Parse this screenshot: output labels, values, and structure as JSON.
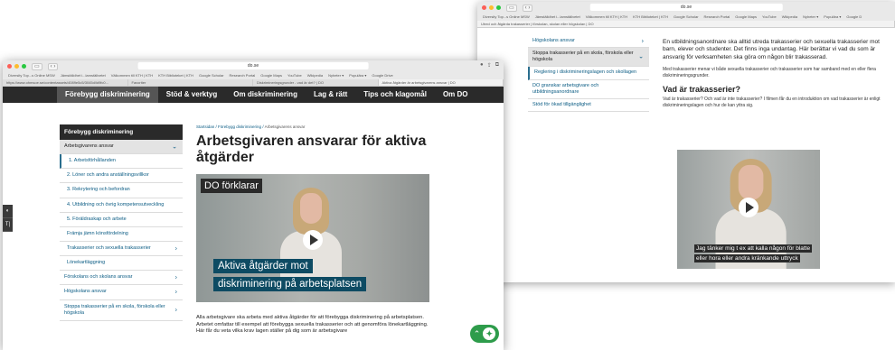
{
  "back_window": {
    "url": "do.se",
    "bookmarks": [
      "Diversity Top...s Online MSW",
      "Jämställdhet i...lamställvetet",
      "Välkommen till KTH | KTH",
      "KTH Biblioteket | KTH",
      "Google Scholar",
      "Research Portal",
      "Google Maps",
      "YouTube",
      "Wikipedia",
      "Nyheter ▾",
      "Populära ▾",
      "Google D"
    ],
    "tab": "Utred och åtgärda trakasserier | förskolan, skolan eller högskolan | DO",
    "sidebar": [
      {
        "label": "Högskolans ansvar",
        "arrow": "›"
      },
      {
        "label": "Stoppa trakasserier på en skola, förskola eller högskola",
        "arrow": "⌄",
        "state": "selected"
      },
      {
        "label": "Reglering i diskrimineringslagen och skollagen",
        "state": "sub-selected"
      },
      {
        "label": "DO granskar arbetsgivare och utbildningsanordnare"
      },
      {
        "label": "Stöd för ökad tillgänglighet"
      }
    ],
    "intro": "En utbildningsanordnare ska alltid utreda trakasserier och sexuella trakasserier mot barn, elever och studenter. Det finns inga undantag. Här berättar vi vad du som är ansvarig för verksamheten ska göra om någon blir trakasserad.",
    "para2": "Med trakasserier menar vi både sexuella trakasserier och trakasserier som har samband med en eller flera diskrimineringsgrunder.",
    "heading": "Vad är trakasserier?",
    "para3": "Vad är trakasserier? Och vad är inte trakasserier? I filmen får du en introduktion om vad trakasserier är enligt diskrimineringslagen och hur de kan yttra sig.",
    "video_subtitles": [
      "Jag tänker mig t ex att kalla någon för blatte",
      "eller hora eller andra kränkande uttryck"
    ]
  },
  "front_window": {
    "url": "do.se",
    "bookmarks": [
      "Diversity Top...s Online MSW",
      "Jämställdhet i...lamställvetet",
      "Välkommen till KTH | KTH",
      "KTH Biblioteket | KTH",
      "Google Scholar",
      "Research Portal",
      "Google Maps",
      "YouTube",
      "Wikipedia",
      "Nyheter ▾",
      "Populära ▾",
      "Google Drive"
    ],
    "tabs": [
      "https://www.ohmsoe.se/contentassets/4089e5c5/3045d/ld9fc0...",
      "Favoriter",
      "Diskrimineringsgrunder - vad är det? | DO",
      "Aktiva åtgärder är arbetsgivarens ansvar | DO"
    ],
    "nav": [
      "Förebygg diskriminering",
      "Stöd & verktyg",
      "Om diskriminering",
      "Lag & rätt",
      "Tips och klagomål",
      "Om DO"
    ],
    "side_tools": [
      "◐",
      "T|"
    ],
    "sidebar_title": "Förebygg diskriminering",
    "sidebar": [
      {
        "label": "Arbetsgivarens ansvar",
        "arrow": "⌄",
        "state": "selected"
      },
      {
        "label": "1. Arbetsförhållanden",
        "state": "sub-selected"
      },
      {
        "label": "2. Löner och andra anställningsvillkor",
        "state": "sub"
      },
      {
        "label": "3. Rekrytering och befordran",
        "state": "sub"
      },
      {
        "label": "4. Utbildning och övrig kompetensutveckling",
        "state": "sub"
      },
      {
        "label": "5. Föräldraskap och arbete",
        "state": "sub"
      },
      {
        "label": "Främja jämn könsfördelning",
        "state": "sub"
      },
      {
        "label": "Trakasserier och sexuella trakasserier",
        "arrow": "›",
        "state": "sub"
      },
      {
        "label": "Lönekartläggning",
        "state": "sub"
      },
      {
        "label": "Förskolans och skolans ansvar",
        "arrow": "›"
      },
      {
        "label": "Högskolans ansvar",
        "arrow": "›"
      },
      {
        "label": "Stoppa trakasserier på en skola, förskola eller högskola",
        "arrow": "›"
      }
    ],
    "breadcrumb": {
      "home": "Startsidan",
      "sep": " / ",
      "level1": "Förebygg diskriminering",
      "current": "Arbetsgivarens ansvar"
    },
    "title": "Arbetsgivaren ansvarar för aktiva åtgärder",
    "video_tag": "DO förklarar",
    "video_caption": [
      "Aktiva åtgärder mot",
      "diskriminering på arbetsplatsen"
    ],
    "paragraph": "Alla arbetsgivare ska arbeta med aktiva åtgärder för att förebygga diskriminering på arbetsplatsen. Arbetet omfattar till exempel att förebygga sexuella trakasserier och att genomföra lönekartläggning. Här får du veta vilka krav lagen ställer på dig som är arbetsgivare",
    "accessibility_button": "⌃"
  }
}
